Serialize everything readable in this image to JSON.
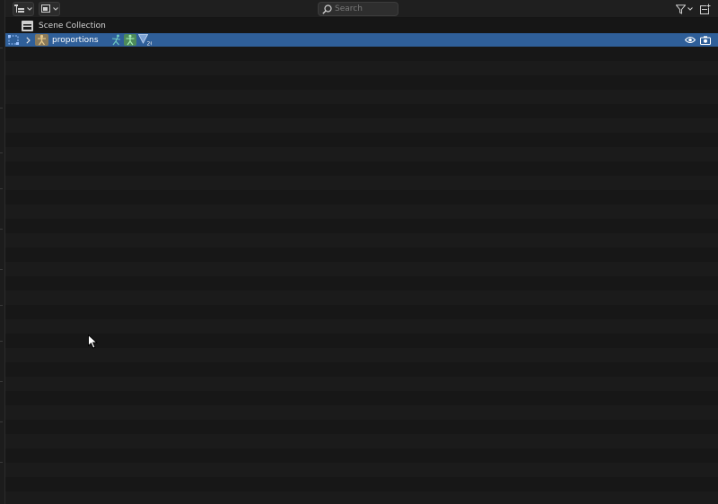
{
  "header": {
    "search_placeholder": "Search"
  },
  "outliner": {
    "scene_collection_label": "Scene Collection",
    "selected_item_label": "proportions"
  },
  "icons": {
    "display_mode": "outliner-list-icon",
    "view_layer": "view-layer-icon",
    "filter": "funnel-icon",
    "new_collection": "new-collection-icon",
    "scene_collection": "collection-box-icon",
    "visibility": "eye-icon",
    "render": "camera-icon",
    "armature": "armature-icon",
    "pose": "pose-icon",
    "modifier": "modifier-icon"
  },
  "colors": {
    "selection": "#2f5f99",
    "background": "#161616",
    "header": "#1f1f1f",
    "text": "#d8d8d8"
  }
}
